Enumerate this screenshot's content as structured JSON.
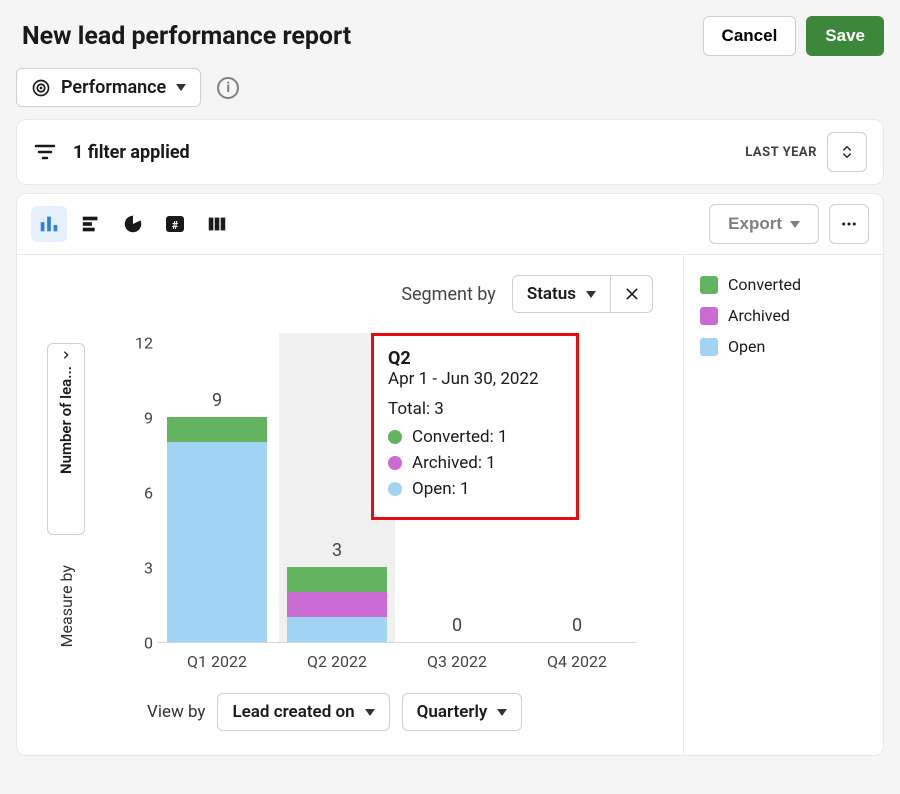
{
  "header": {
    "title": "New lead performance report",
    "cancel": "Cancel",
    "save": "Save"
  },
  "metric": {
    "label": "Performance"
  },
  "filter": {
    "applied": "1 filter applied",
    "range_label": "LAST YEAR"
  },
  "toolbar": {
    "export": "Export"
  },
  "segment": {
    "label": "Segment by",
    "value": "Status"
  },
  "legend": {
    "items": [
      {
        "label": "Converted",
        "color": "#62b461"
      },
      {
        "label": "Archived",
        "color": "#c96bd3"
      },
      {
        "label": "Open",
        "color": "#a1d3f2"
      }
    ]
  },
  "axis": {
    "y_title": "Number of lea...",
    "measure_by": "Measure by",
    "y_ticks": [
      0,
      3,
      6,
      9,
      12
    ]
  },
  "tooltip": {
    "title": "Q2",
    "subtitle": "Apr 1 - Jun 30, 2022",
    "total_label": "Total: 3",
    "items": [
      {
        "label": "Converted: 1",
        "color": "#62b461"
      },
      {
        "label": "Archived: 1",
        "color": "#c96bd3"
      },
      {
        "label": "Open: 1",
        "color": "#a1d3f2"
      }
    ]
  },
  "viewby": {
    "label": "View by",
    "field": "Lead created on",
    "granularity": "Quarterly"
  },
  "chart_data": {
    "type": "bar",
    "stacked": true,
    "categories": [
      "Q1 2022",
      "Q2 2022",
      "Q3 2022",
      "Q4 2022"
    ],
    "series": [
      {
        "name": "Open",
        "values": [
          8,
          1,
          0,
          0
        ],
        "color": "#a1d3f2"
      },
      {
        "name": "Archived",
        "values": [
          0,
          1,
          0,
          0
        ],
        "color": "#c96bd3"
      },
      {
        "name": "Converted",
        "values": [
          1,
          1,
          0,
          0
        ],
        "color": "#62b461"
      }
    ],
    "totals": [
      9,
      3,
      0,
      0
    ],
    "xlabel": "",
    "ylabel": "Number of leads",
    "ylim": [
      0,
      12
    ],
    "highlight_index": 1
  }
}
